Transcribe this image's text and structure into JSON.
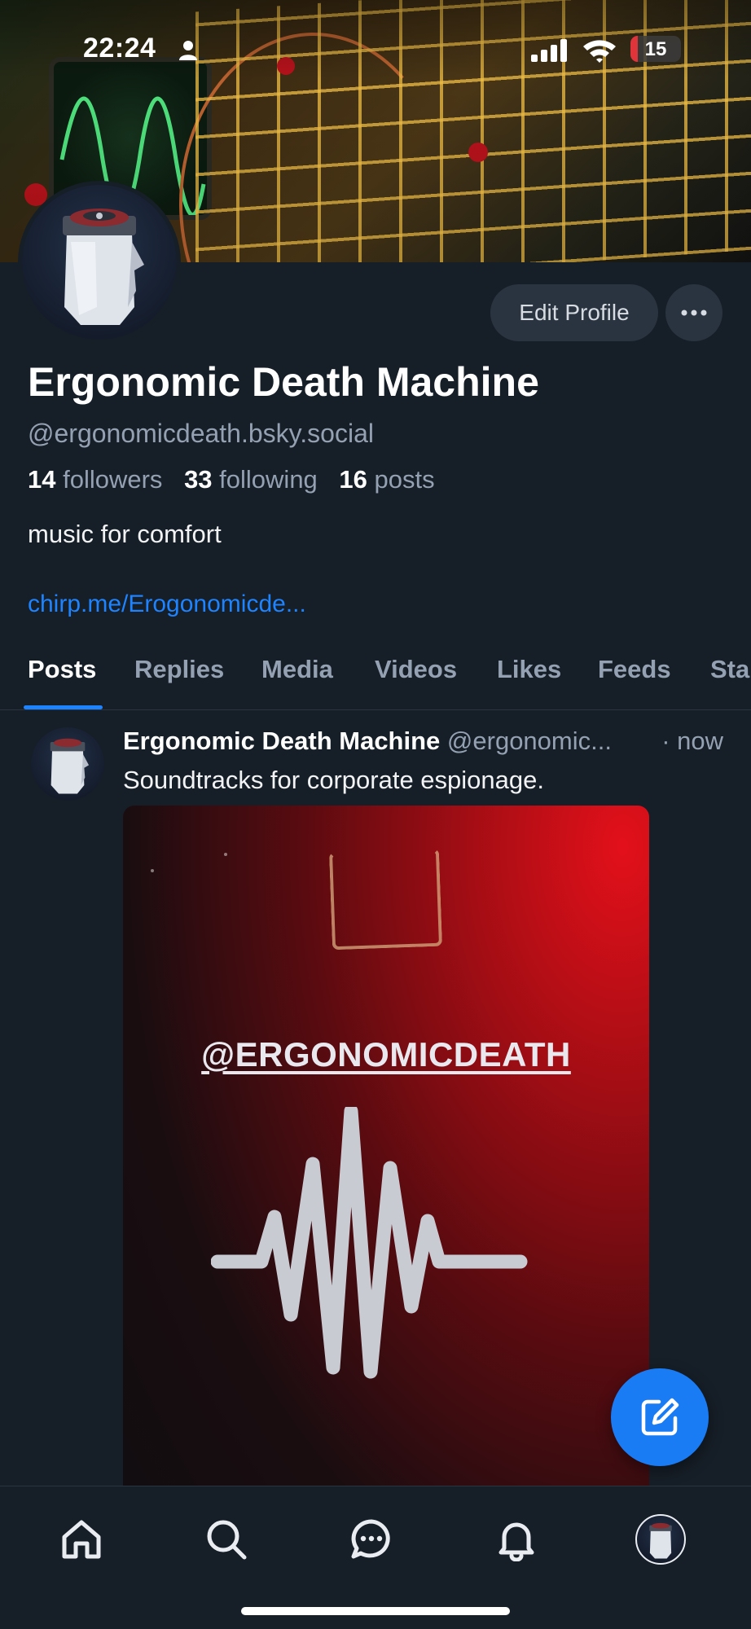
{
  "status_bar": {
    "time": "22:24",
    "battery": "15",
    "battery_level": 0.15
  },
  "profile": {
    "display_name": "Ergonomic Death Machine",
    "handle": "@ergonomicdeath.bsky.social",
    "followers_count": "14",
    "followers_label": "followers",
    "following_count": "33",
    "following_label": "following",
    "posts_count": "16",
    "posts_label": "posts",
    "bio": "music for comfort",
    "link": "chirp.me/Erogonomicde..."
  },
  "actions": {
    "edit_profile": "Edit Profile"
  },
  "tabs": [
    {
      "label": "Posts",
      "active": true
    },
    {
      "label": "Replies"
    },
    {
      "label": "Media"
    },
    {
      "label": "Videos"
    },
    {
      "label": "Likes"
    },
    {
      "label": "Feeds"
    },
    {
      "label": "Sta"
    }
  ],
  "post": {
    "author_name": "Ergonomic Death Machine",
    "author_handle": "@ergonomic...",
    "time": "· now",
    "text": "Soundtracks for corporate espionage.",
    "media_caption": "@ERGONOMICDEATH"
  },
  "nav": [
    "home-icon",
    "search-icon",
    "chat-icon",
    "bell-icon",
    "profile-avatar"
  ],
  "colors": {
    "accent": "#1e83ff",
    "background": "#161e27",
    "fab": "#1a7cf5"
  }
}
